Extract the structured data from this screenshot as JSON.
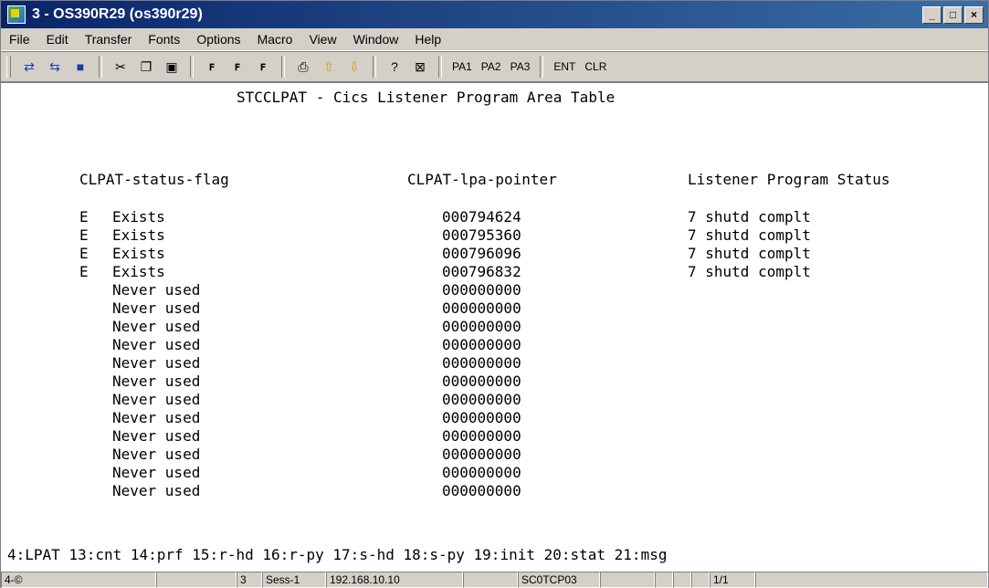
{
  "window": {
    "title": "3 - OS390R29 (os390r29)",
    "minimize": "_",
    "maximize": "□",
    "close": "×"
  },
  "menu": [
    "File",
    "Edit",
    "Transfer",
    "Fonts",
    "Options",
    "Macro",
    "View",
    "Window",
    "Help"
  ],
  "toolbar": {
    "pa1": "PA1",
    "pa2": "PA2",
    "pa3": "PA3",
    "ent": "ENT",
    "clr": "CLR"
  },
  "screen": {
    "title": "STCCLPAT - Cics Listener Program Area Table",
    "headers": {
      "status_flag": "CLPAT-status-flag",
      "lpa_pointer": "CLPAT-lpa-pointer",
      "listener_status": "Listener Program Status"
    },
    "rows": [
      {
        "flag": "E",
        "status": "Exists",
        "pointer": "000794624",
        "listener": "7 shutd complt"
      },
      {
        "flag": "E",
        "status": "Exists",
        "pointer": "000795360",
        "listener": "7 shutd complt"
      },
      {
        "flag": "E",
        "status": "Exists",
        "pointer": "000796096",
        "listener": "7 shutd complt"
      },
      {
        "flag": "E",
        "status": "Exists",
        "pointer": "000796832",
        "listener": "7 shutd complt"
      },
      {
        "flag": "",
        "status": "Never used",
        "pointer": "000000000",
        "listener": ""
      },
      {
        "flag": "",
        "status": "Never used",
        "pointer": "000000000",
        "listener": ""
      },
      {
        "flag": "",
        "status": "Never used",
        "pointer": "000000000",
        "listener": ""
      },
      {
        "flag": "",
        "status": "Never used",
        "pointer": "000000000",
        "listener": ""
      },
      {
        "flag": "",
        "status": "Never used",
        "pointer": "000000000",
        "listener": ""
      },
      {
        "flag": "",
        "status": "Never used",
        "pointer": "000000000",
        "listener": ""
      },
      {
        "flag": "",
        "status": "Never used",
        "pointer": "000000000",
        "listener": ""
      },
      {
        "flag": "",
        "status": "Never used",
        "pointer": "000000000",
        "listener": ""
      },
      {
        "flag": "",
        "status": "Never used",
        "pointer": "000000000",
        "listener": ""
      },
      {
        "flag": "",
        "status": "Never used",
        "pointer": "000000000",
        "listener": ""
      },
      {
        "flag": "",
        "status": "Never used",
        "pointer": "000000000",
        "listener": ""
      },
      {
        "flag": "",
        "status": "Never used",
        "pointer": "000000000",
        "listener": ""
      }
    ],
    "function_keys": "4:LPAT 13:cnt 14:prf 15:r-hd 16:r-py 17:s-hd 18:s-py 19:init 20:stat 21:msg"
  },
  "status": {
    "cursor": "4-©",
    "session_num": "3",
    "session_name": "Sess-1",
    "ip": "192.168.10.10",
    "lu": "SC0TCP03",
    "page": "1/1"
  }
}
